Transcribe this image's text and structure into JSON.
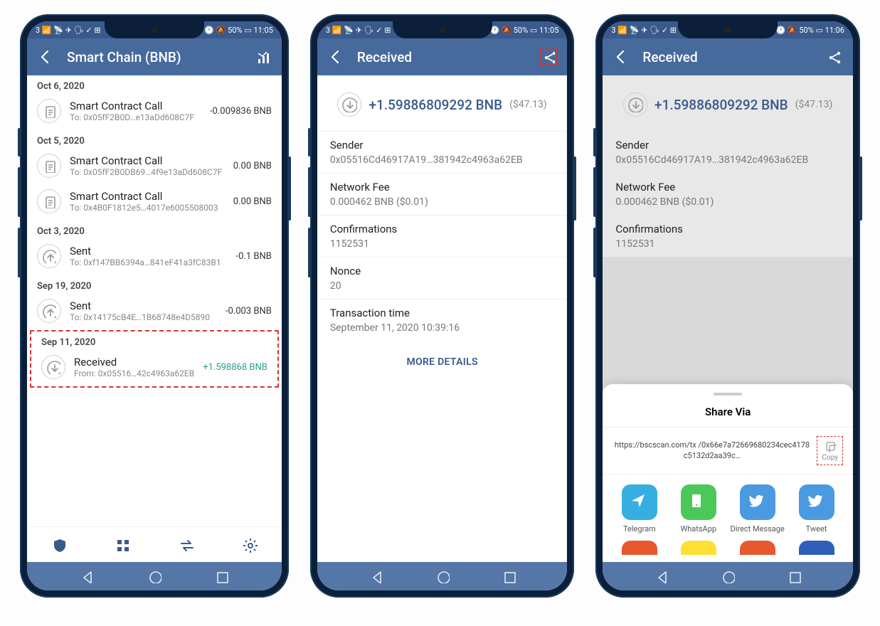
{
  "statusbar": {
    "left": "3 📶 📡 ✈ 🗣 ✓ ⊞",
    "right1": "ℕ 🕐 🔕 50% ▭ 11:05",
    "right3": "ℕ 🕐 🔕 50% ▭ 11:06"
  },
  "screen1": {
    "title": "Smart Chain (BNB)",
    "groups": [
      {
        "date": "Oct 6, 2020",
        "items": [
          {
            "icon": "contract",
            "title": "Smart Contract Call",
            "sub": "To: 0x05fF2B0D…e13aDd608C7F",
            "amt": "-0.009836 BNB"
          }
        ]
      },
      {
        "date": "Oct 5, 2020",
        "items": [
          {
            "icon": "contract",
            "title": "Smart Contract Call",
            "sub": "To: 0x05fF2B0DB69…4f9e13aDd608C7F",
            "amt": "0.00 BNB"
          },
          {
            "icon": "contract",
            "title": "Smart Contract Call",
            "sub": "To: 0x4B0F1812e5…4017e6005508003",
            "amt": "0.00 BNB"
          }
        ]
      },
      {
        "date": "Oct 3, 2020",
        "items": [
          {
            "icon": "sent",
            "title": "Sent",
            "sub": "To: 0xf147BB6394a…841eF41a3fC83B1",
            "amt": "-0.1 BNB"
          }
        ]
      },
      {
        "date": "Sep 19, 2020",
        "items": [
          {
            "icon": "sent",
            "title": "Sent",
            "sub": "To: 0x14175cB4E…1B68748e4D5890",
            "amt": "-0.003 BNB"
          }
        ]
      },
      {
        "date": "Sep 11, 2020",
        "highlight": true,
        "items": [
          {
            "icon": "received",
            "title": "Received",
            "sub": "From: 0x05516…42c4963a62EB",
            "amt": "+1.598868 BNB",
            "pos": true
          }
        ]
      }
    ]
  },
  "screen2": {
    "title": "Received",
    "amount": "+1.59886809292 BNB",
    "usd": "($47.13)",
    "details": [
      {
        "label": "Sender",
        "value": "0x05516Cd46917A19…381942c4963a62EB"
      },
      {
        "label": "Network Fee",
        "value": "0.000462 BNB ($0.01)"
      },
      {
        "label": "Confirmations",
        "value": "1152531"
      },
      {
        "label": "Nonce",
        "value": "20"
      },
      {
        "label": "Transaction time",
        "value": "September 11, 2020 10:39:16"
      }
    ],
    "more": "MORE DETAILS"
  },
  "screen3": {
    "title": "Received",
    "amount": "+1.59886809292 BNB",
    "usd": "($47.13)",
    "details": [
      {
        "label": "Sender",
        "value": "0x05516Cd46917A19…381942c4963a62EB"
      },
      {
        "label": "Network Fee",
        "value": "0.000462 BNB ($0.01)"
      },
      {
        "label": "Confirmations",
        "value": "1152531"
      }
    ],
    "sheet": {
      "title": "Share Via",
      "link": "https://bscscan.com/tx /0x66e7a72669680234cec4178c5132d2aa39c…",
      "copy": "Copy",
      "apps": [
        {
          "name": "Telegram",
          "color": "#37aee2"
        },
        {
          "name": "WhatsApp",
          "color": "#4ac959"
        },
        {
          "name": "Direct Message",
          "color": "#4a9ae1"
        },
        {
          "name": "Tweet",
          "color": "#4a9ae1"
        }
      ],
      "apps2_colors": [
        "#e8582f",
        "#fde033",
        "#e8582f",
        "#2f5fb8"
      ]
    }
  }
}
